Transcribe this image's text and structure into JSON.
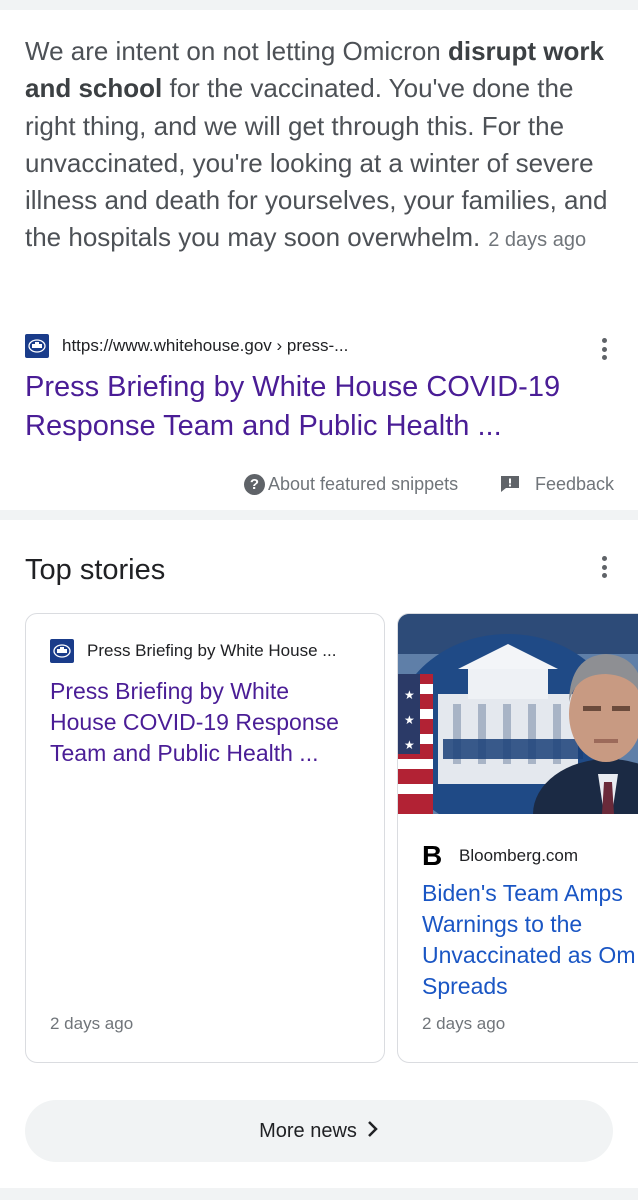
{
  "snippet": {
    "text_before": "We are intent on not letting Omicron ",
    "text_bold": "disrupt work and school",
    "text_after": " for the vaccinated. You've done the right thing, and we will get through this. For the unvaccinated, you're looking at a winter of severe illness and death for yourselves, your families, and the hospitals you may soon overwhelm.",
    "date": "2 days ago",
    "source_url": "https://www.whitehouse.gov › press-...",
    "title": "Press Briefing by White House COVID-19 Response Team and Public Health ...",
    "about_label": "About featured snippets",
    "feedback_label": "Feedback",
    "icons": {
      "favicon": "white-house-seal-icon",
      "menu": "more-vert-icon",
      "help": "help-circle-icon",
      "feedback": "feedback-icon"
    }
  },
  "top_stories": {
    "title": "Top stories",
    "stories": [
      {
        "source": "Press Briefing by White House ...",
        "headline": "Press Briefing by White House COVID-19 Response Team and Public Health ...",
        "date": "2 days ago"
      },
      {
        "source": "Bloomberg.com",
        "logo_letter": "B",
        "headline_lines": [
          "Biden's Team Amps",
          "Warnings to the",
          "Unvaccinated as Om",
          "Spreads"
        ],
        "date": "2 days ago"
      }
    ],
    "more_news_label": "More news",
    "more_news_icon": "chevron-right-icon"
  },
  "colors": {
    "visited_link": "#4a1d96",
    "link": "#1a56c4",
    "secondary_text": "#70757a"
  }
}
